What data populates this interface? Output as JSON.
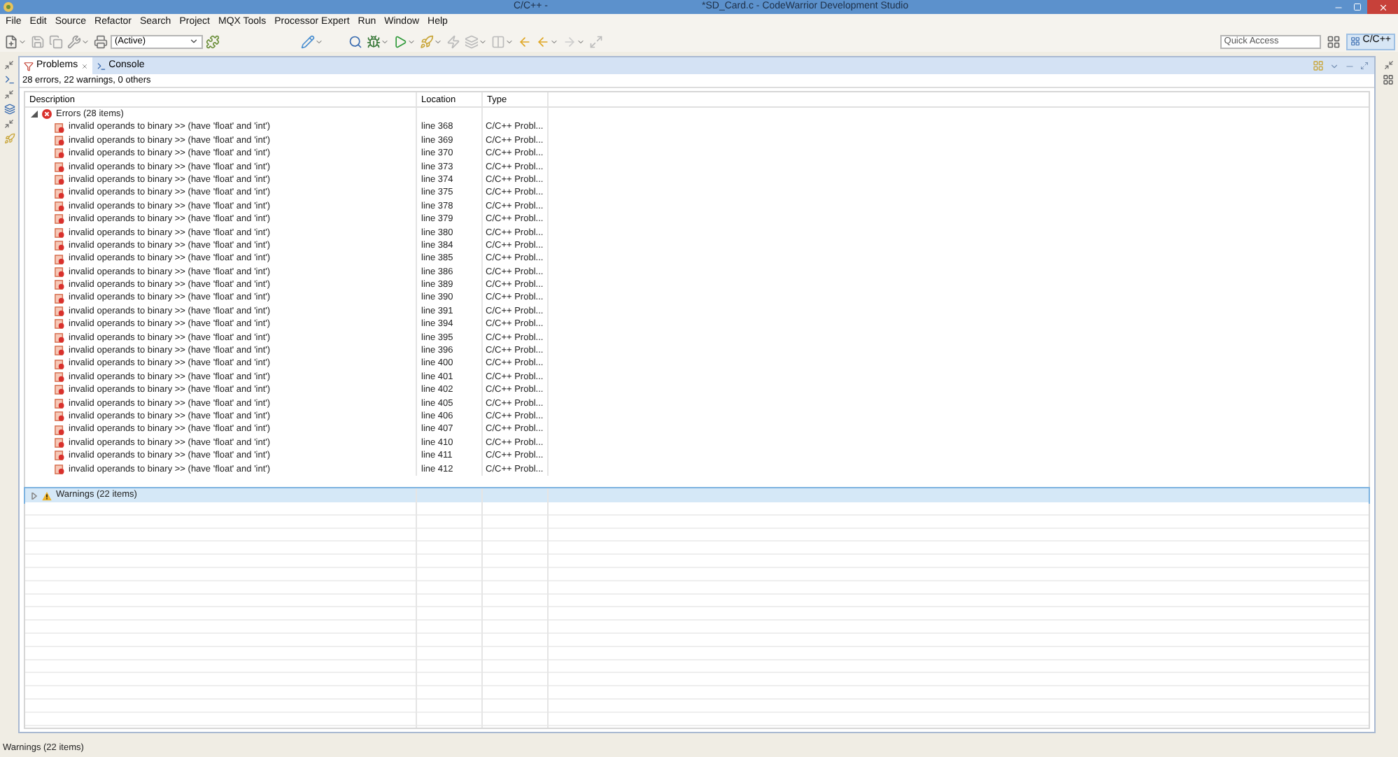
{
  "window": {
    "title_left": "C/C++ -",
    "title_right": "*SD_Card.c - CodeWarrior Development Studio"
  },
  "menu": [
    "File",
    "Edit",
    "Source",
    "Refactor",
    "Search",
    "Project",
    "MQX Tools",
    "Processor Expert",
    "Run",
    "Window",
    "Help"
  ],
  "toolbar": {
    "config_combo": "(Active)",
    "quick_access": {
      "placeholder": "Quick Access"
    },
    "perspective": {
      "label": "C/C++",
      "selected": true
    }
  },
  "tabs": [
    {
      "label": "Problems",
      "selected": true,
      "closable": true
    },
    {
      "label": "Console",
      "selected": false,
      "closable": false
    }
  ],
  "summary": "28 errors, 22 warnings, 0 others",
  "table": {
    "columns": [
      "Description",
      "Location",
      "Type"
    ],
    "groups": [
      {
        "label": "Errors (28 items)",
        "kind": "error",
        "expanded": true,
        "selected": false,
        "children": [
          {
            "description": "invalid operands to binary >> (have 'float' and 'int')",
            "location": "line 368",
            "type": "C/C++ Probl..."
          },
          {
            "description": "invalid operands to binary >> (have 'float' and 'int')",
            "location": "line 369",
            "type": "C/C++ Probl..."
          },
          {
            "description": "invalid operands to binary >> (have 'float' and 'int')",
            "location": "line 370",
            "type": "C/C++ Probl..."
          },
          {
            "description": "invalid operands to binary >> (have 'float' and 'int')",
            "location": "line 373",
            "type": "C/C++ Probl..."
          },
          {
            "description": "invalid operands to binary >> (have 'float' and 'int')",
            "location": "line 374",
            "type": "C/C++ Probl..."
          },
          {
            "description": "invalid operands to binary >> (have 'float' and 'int')",
            "location": "line 375",
            "type": "C/C++ Probl..."
          },
          {
            "description": "invalid operands to binary >> (have 'float' and 'int')",
            "location": "line 378",
            "type": "C/C++ Probl..."
          },
          {
            "description": "invalid operands to binary >> (have 'float' and 'int')",
            "location": "line 379",
            "type": "C/C++ Probl..."
          },
          {
            "description": "invalid operands to binary >> (have 'float' and 'int')",
            "location": "line 380",
            "type": "C/C++ Probl..."
          },
          {
            "description": "invalid operands to binary >> (have 'float' and 'int')",
            "location": "line 384",
            "type": "C/C++ Probl..."
          },
          {
            "description": "invalid operands to binary >> (have 'float' and 'int')",
            "location": "line 385",
            "type": "C/C++ Probl..."
          },
          {
            "description": "invalid operands to binary >> (have 'float' and 'int')",
            "location": "line 386",
            "type": "C/C++ Probl..."
          },
          {
            "description": "invalid operands to binary >> (have 'float' and 'int')",
            "location": "line 389",
            "type": "C/C++ Probl..."
          },
          {
            "description": "invalid operands to binary >> (have 'float' and 'int')",
            "location": "line 390",
            "type": "C/C++ Probl..."
          },
          {
            "description": "invalid operands to binary >> (have 'float' and 'int')",
            "location": "line 391",
            "type": "C/C++ Probl..."
          },
          {
            "description": "invalid operands to binary >> (have 'float' and 'int')",
            "location": "line 394",
            "type": "C/C++ Probl..."
          },
          {
            "description": "invalid operands to binary >> (have 'float' and 'int')",
            "location": "line 395",
            "type": "C/C++ Probl..."
          },
          {
            "description": "invalid operands to binary >> (have 'float' and 'int')",
            "location": "line 396",
            "type": "C/C++ Probl..."
          },
          {
            "description": "invalid operands to binary >> (have 'float' and 'int')",
            "location": "line 400",
            "type": "C/C++ Probl..."
          },
          {
            "description": "invalid operands to binary >> (have 'float' and 'int')",
            "location": "line 401",
            "type": "C/C++ Probl..."
          },
          {
            "description": "invalid operands to binary >> (have 'float' and 'int')",
            "location": "line 402",
            "type": "C/C++ Probl..."
          },
          {
            "description": "invalid operands to binary >> (have 'float' and 'int')",
            "location": "line 405",
            "type": "C/C++ Probl..."
          },
          {
            "description": "invalid operands to binary >> (have 'float' and 'int')",
            "location": "line 406",
            "type": "C/C++ Probl..."
          },
          {
            "description": "invalid operands to binary >> (have 'float' and 'int')",
            "location": "line 407",
            "type": "C/C++ Probl..."
          },
          {
            "description": "invalid operands to binary >> (have 'float' and 'int')",
            "location": "line 410",
            "type": "C/C++ Probl..."
          },
          {
            "description": "invalid operands to binary >> (have 'float' and 'int')",
            "location": "line 411",
            "type": "C/C++ Probl..."
          },
          {
            "description": "invalid operands to binary >> (have 'float' and 'int')",
            "location": "line 412",
            "type": "C/C++ Probl..."
          }
        ]
      },
      {
        "label": "Warnings (22 items)",
        "kind": "warning",
        "expanded": false,
        "selected": true
      }
    ]
  },
  "status_bar": "Warnings (22 items)"
}
